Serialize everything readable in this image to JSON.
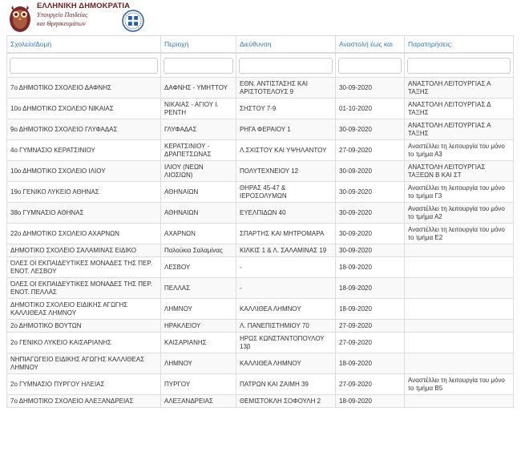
{
  "header": {
    "line1": "ΕΛΛΗΝΙΚΗ ΔΗΜΟΚΡΑΤΙΑ",
    "line2": "Υπουργείο Παιδείας",
    "line3": "και Θρησκευμάτων",
    "accent_color": "#6b2222",
    "icons": [
      "owl-logo-icon",
      "greek-seal-icon"
    ]
  },
  "table": {
    "columns": [
      "Σχολείο/Δομή",
      "Περιοχή",
      "Διεύθυνση",
      "Αναστολή έως και",
      "Παρατηρήσεις:"
    ],
    "filters": [
      "",
      "",
      "",
      "",
      ""
    ],
    "rows": [
      [
        "7ο ΔΗΜΟΤΙΚΟ ΣΧΟΛΕΙΟ ΔΑΦΝΗΣ",
        "ΔΑΦΝΗΣ - ΥΜΗΤΤΟΥ",
        "ΕΘΝ. ΑΝΤΙΣΤΑΣΗΣ ΚΑΙ ΑΡΙΣΤΟΤΕΛΟΥΣ 9",
        "30-09-2020",
        "ΑΝΑΣΤΟΛΗ ΛΕΙΤΟΥΡΓΙΑΣ Α ΤΑΞΗΣ"
      ],
      [
        "10ο ΔΗΜΟΤΙΚΟ ΣΧΟΛΕΙΟ ΝΙΚΑΙΑΣ",
        "ΝΙΚΑΙΑΣ - ΑΓΙΟΥ Ι. ΡΕΝΤΗ",
        "ΣΗΣΤΟΥ 7-9",
        "01-10-2020",
        "ΑΝΑΣΤΟΛΗ ΛΕΙΤΟΥΡΓΙΑΣ Δ ΤΑΞΗΣ"
      ],
      [
        "9ο ΔΗΜΟΤΙΚΟ ΣΧΟΛΕΙΟ ΓΛΥΦΑΔΑΣ",
        "ΓΛΥΦΑΔΑΣ",
        "ΡΗΓΑ ΦΕΡΑΙΟΥ 1",
        "30-09-2020",
        "ΑΝΑΣΤΟΛΗ ΛΕΙΤΟΥΡΓΙΑΣ Α ΤΑΞΗΣ"
      ],
      [
        "4ο ΓΥΜΝΑΣΙΟ ΚΕΡΑΤΣΙΝΙΟΥ",
        "ΚΕΡΑΤΣΙΝΙΟΥ - ΔΡΑΠΕΤΣΩΝΑΣ",
        "Λ.ΣΧΙΣΤΟΥ ΚΑΙ ΥΨΗΛΑΝΤΟΥ",
        "27-09-2020",
        "Αναστέλλει τη λειτουργία του μόνο το τμήμα Α3"
      ],
      [
        "10ο ΔΗΜΟΤΙΚΟ ΣΧΟΛΕΙΟ ΙΛΙΟΥ",
        "ΙΛΙΟΥ (ΝΕΩΝ ΛΙΟΣΙΩΝ)",
        "ΠΟΛΥΤΕΧΝΕΙΟΥ 12",
        "30-09-2020",
        "ΑΝΑΣΤΟΛΗ ΛΕΙΤΟΥΡΓΙΑΣ ΤΑΞΕΩΝ Β ΚΑΙ ΣΤ"
      ],
      [
        "19ο ΓΕΝΙΚΟ ΛΥΚΕΙΟ ΑΘΗΝΑΣ",
        "ΑΘΗΝΑΙΩΝ",
        "ΘΗΡΑΣ 45-47 & ΙΕΡΟΣΟΛΥΜΩΝ",
        "30-09-2020",
        "Αναστέλλει τη λειτουργία του μόνο το τμήμα Γ3"
      ],
      [
        "38ο ΓΥΜΝΑΣΙΟ ΑΘΗΝΑΣ",
        "ΑΘΗΝΑΙΩΝ",
        "ΕΥΕΛΠΙΔΩΝ 40",
        "30-09-2020",
        "Αναστέλλει τη λειτουργία του μόνο το τμήμα Α2"
      ],
      [
        "22ο ΔΗΜΟΤΙΚΟ ΣΧΟΛΕΙΟ ΑΧΑΡΝΩΝ",
        "ΑΧΑΡΝΩΝ",
        "ΣΠΑΡΤΗΣ ΚΑΙ ΜΗΤΡΟΜΑΡΑ",
        "30-09-2020",
        "Αναστέλλει τη λειτουργία του μόνο το τμήμα Ε2"
      ],
      [
        "ΔΗΜΟΤΙΚΟ ΣΧΟΛΕΙΟ ΣΑΛΑΜΙΝΑΣ ΕΙΔΙΚΟ",
        "Παλούκια Σαλαμίνας",
        "ΚΙΛΚΙΣ 1 & Λ. ΣΑΛΑΜΙΝΑΣ 19",
        "30-09-2020",
        ""
      ],
      [
        "ΌΛΕΣ ΟΙ ΕΚΠΑΙΔΕΥΤΙΚΕΣ ΜΟΝΑΔΕΣ ΤΗΣ ΠΕΡ. ΕΝΟΤ. ΛΕΣΒΟΥ",
        "ΛΕΣΒΟΥ",
        "-",
        "18-09-2020",
        ""
      ],
      [
        "ΌΛΕΣ ΟΙ ΕΚΠΑΙΔΕΥΤΙΚΕΣ ΜΟΝΑΔΕΣ ΤΗΣ ΠΕΡ. ΕΝΟΤ. ΠΕΛΛΑΣ",
        "ΠΕΛΛΑΣ",
        "-",
        "18-09-2020",
        ""
      ],
      [
        "ΔΗΜΟΤΙΚΟ ΣΧΟΛΕΙΟ ΕΙΔΙΚΗΣ ΑΓΩΓΗΣ ΚΑΛΛΙΘΕΑΣ ΛΗΜΝΟΥ",
        "ΛΗΜΝΟΥ",
        "ΚΑΛΛΙΘΕΑ ΛΗΜΝΟΥ",
        "18-09-2020",
        ""
      ],
      [
        "2ο ΔΗΜΟΤΙΚΟ ΒΟΥΤΩΝ",
        "ΗΡΑΚΛΕΙΟΥ",
        "Λ. ΠΑΝΕΠΙΣΤΗΜΙΟΥ 70",
        "27-09-2020",
        ""
      ],
      [
        "2ο ΓΕΝΙΚΟ ΛΥΚΕΙΟ ΚΑΙΣΑΡΙΑΝΗΣ",
        "ΚΑΙΣΑΡΙΑΝΗΣ",
        "ΗΡΩΣ ΚΩΝΣΤΑΝΤΟΠΟΥΛΟΥ 13β",
        "27-09-2020",
        ""
      ],
      [
        "ΝΗΠΙΑΓΩΓΕΙΟ ΕΙΔΙΚΗΣ ΑΓΩΓΗΣ ΚΑΛΛΙΘΕΑΣ ΛΗΜΝΟΥ",
        "ΛΗΜΝΟΥ",
        "ΚΑΛΛΙΘΕΑ ΛΗΜΝΟΥ",
        "18-09-2020",
        ""
      ],
      [
        "2ο ΓΥΜΝΑΣΙΟ ΠΥΡΓΟΥ ΗΛΕΙΑΣ",
        "ΠΥΡΓΟΥ",
        "ΠΑΤΡΩΝ ΚΑΙ ΖΑΙΜΗ 39",
        "27-09-2020",
        "Αναστέλλει τη λειτουργία του μόνο το τμήμα Β5"
      ],
      [
        "7ο ΔΗΜΟΤΙΚΟ ΣΧΟΛΕΙΟ ΑΛΕΞΑΝΔΡΕΙΑΣ",
        "ΑΛΕΞΑΝΔΡΕΙΑΣ",
        "ΘΕΜΙΣΤΟΚΛΗ ΣΟΦΟΥΛΗ 2",
        "18-09-2020",
        ""
      ]
    ]
  }
}
